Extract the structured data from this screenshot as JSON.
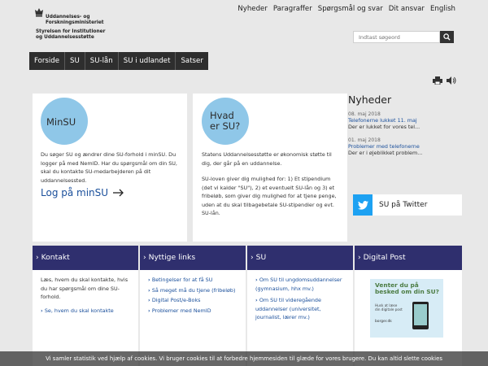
{
  "logo": {
    "line1": "Uddannelses- og",
    "line2": "Forskningsministeriet",
    "line3": "Styrelsen for Institutioner",
    "line4": "og Uddannelsesstøtte"
  },
  "topnav": [
    "Nyheder",
    "Paragraffer",
    "Spørgsmål og svar",
    "Dit ansvar",
    "English"
  ],
  "search": {
    "placeholder": "Indtast søgeord"
  },
  "mainnav": [
    "Forside",
    "SU",
    "SU-lån",
    "SU i udlandet",
    "Satser"
  ],
  "minsu": {
    "circle": "MinSU",
    "body": "Du søger SU og ændrer dine SU-forhold i minSU. Du logger på med NemID. Har du spørgsmål om din SU, skal du kontakte SU-medarbejderen på dit uddannelsessted.",
    "login": "Log på minSU"
  },
  "hvad": {
    "circle_l1": "Hvad",
    "circle_l2": "er SU?",
    "p1": "Statens Uddannelsesstøtte er økonomisk støtte til dig, der går på en uddannelse.",
    "p2": "SU-loven giver dig mulighed for: 1) Et stipendium (det vi kalder \"SU\"), 2) et eventuelt SU-lån og 3) et fribeløb, som giver dig mulighed for at tjene penge, uden at du skal tilbagebetale SU-stipendier og evt. SU-lån."
  },
  "news": {
    "title": "Nyheder",
    "items": [
      {
        "date": "08. maj 2018",
        "title": "Telefonerne lukket 11. maj",
        "text": "Der er lukket for vores tel..."
      },
      {
        "date": "01. maj 2018",
        "title": "Problemer med telefonerne",
        "text": "Der er i øjeblikket problem..."
      }
    ]
  },
  "twitter": {
    "label": "SU på Twitter"
  },
  "boxes": {
    "kontakt": {
      "title": "Kontakt",
      "text": "Læs, hvem du skal kontakte, hvis du har spørgsmål om dine SU-forhold.",
      "link": "Se, hvem du skal kontakte"
    },
    "nyttige": {
      "title": "Nyttige links",
      "links": [
        "Betingelser for at få SU",
        "Så meget må du tjene (fribeløb)",
        "Digital Post/e-Boks",
        "Problemer med NemID"
      ]
    },
    "su": {
      "title": "SU",
      "links": [
        "Om SU til ungdomsuddannelser (gymnasium, hhx mv.)",
        "Om SU til videregående uddannelser (universitet, journalist, lærer mv.)"
      ]
    },
    "digital": {
      "title": "Digital Post",
      "ad_title": "Venter du på besked om din SU?",
      "ad_sub": "Husk at læse din digitale post",
      "ad_brand": "borger.dk"
    }
  },
  "cookie": {
    "text": "Vi samler statistik ved hjælp af cookies. Vi bruger cookies til at forbedre hjemmesiden til glæde for vores brugere. Du kan altid slette cookies"
  },
  "colors": {
    "accent": "#2f2f6e",
    "circle": "#8fc7e8",
    "link": "#1a4f9b",
    "twitter": "#1da1f2"
  }
}
